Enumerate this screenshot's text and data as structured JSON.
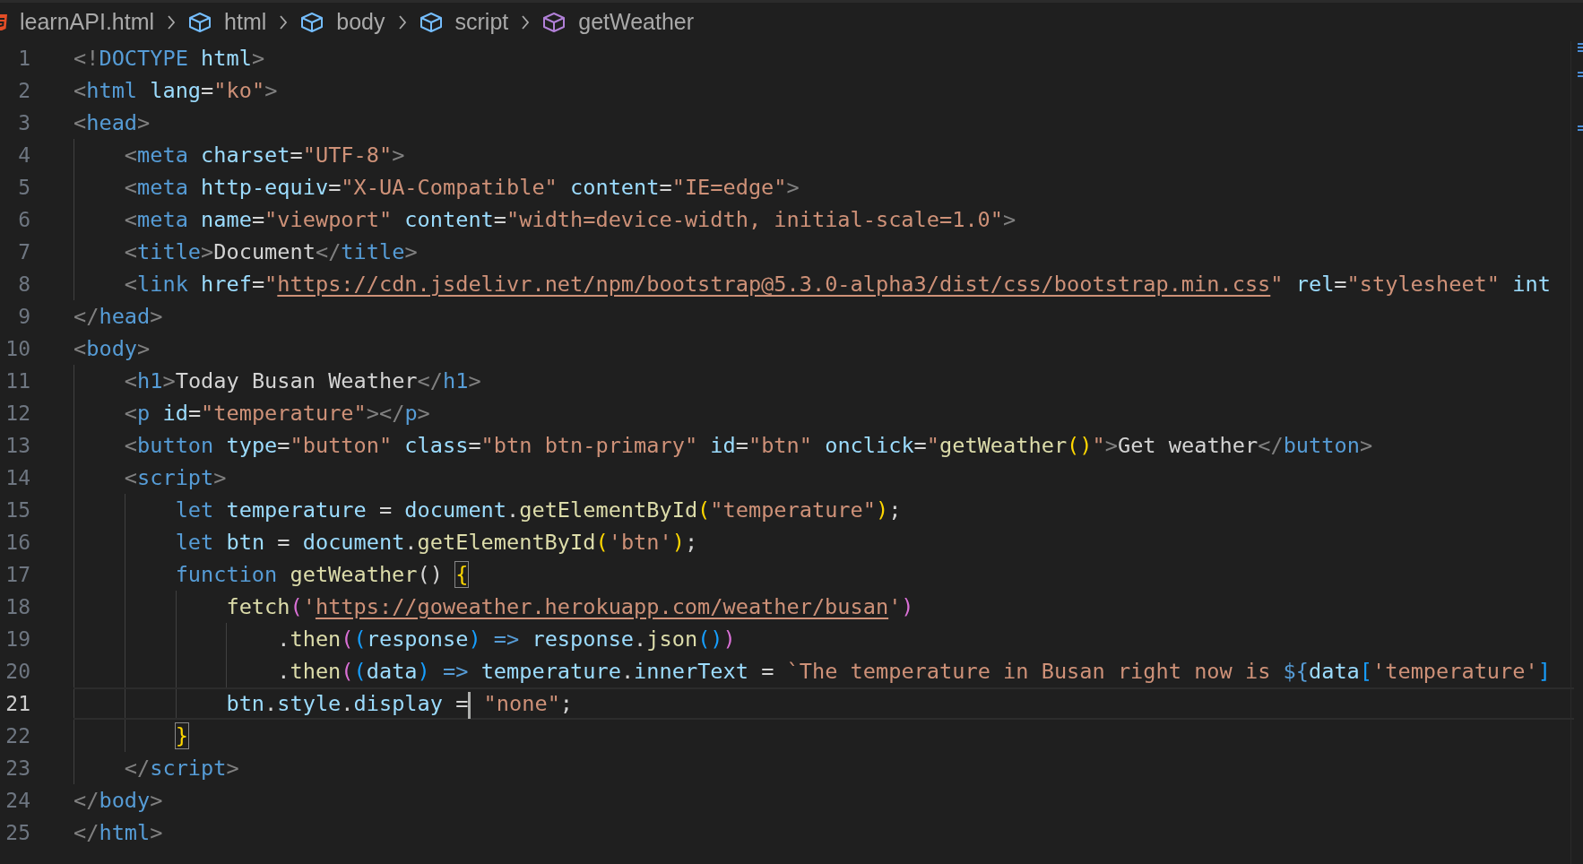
{
  "breadcrumb": [
    {
      "label": "learnAPI.html",
      "kind": "file"
    },
    {
      "label": "html",
      "kind": "element"
    },
    {
      "label": "body",
      "kind": "element"
    },
    {
      "label": "script",
      "kind": "element"
    },
    {
      "label": "getWeather",
      "kind": "function"
    }
  ],
  "lines": [
    {
      "number": "1",
      "current": false,
      "tokens": [
        {
          "text": "<!",
          "kind": "punct"
        },
        {
          "text": "DOCTYPE",
          "kind": "tag"
        },
        {
          "text": " html",
          "kind": "attr"
        },
        {
          "text": ">",
          "kind": "punct"
        }
      ]
    },
    {
      "number": "2",
      "current": false,
      "tokens": [
        {
          "text": "<",
          "kind": "punct"
        },
        {
          "text": "html",
          "kind": "tag"
        },
        {
          "text": " lang",
          "kind": "attr"
        },
        {
          "text": "=",
          "kind": "text"
        },
        {
          "text": "\"ko\"",
          "kind": "string"
        },
        {
          "text": ">",
          "kind": "punct"
        }
      ]
    },
    {
      "number": "3",
      "current": false,
      "tokens": [
        {
          "text": "<",
          "kind": "punct"
        },
        {
          "text": "head",
          "kind": "tag"
        },
        {
          "text": ">",
          "kind": "punct"
        }
      ]
    },
    {
      "number": "4",
      "current": false,
      "tokens": [
        {
          "text": "    <",
          "kind": "punct"
        },
        {
          "text": "meta",
          "kind": "tag"
        },
        {
          "text": " charset",
          "kind": "attr"
        },
        {
          "text": "=",
          "kind": "text"
        },
        {
          "text": "\"UTF-8\"",
          "kind": "string"
        },
        {
          "text": ">",
          "kind": "punct"
        }
      ]
    },
    {
      "number": "5",
      "current": false,
      "tokens": [
        {
          "text": "    <",
          "kind": "punct"
        },
        {
          "text": "meta",
          "kind": "tag"
        },
        {
          "text": " http-equiv",
          "kind": "attr"
        },
        {
          "text": "=",
          "kind": "text"
        },
        {
          "text": "\"X-UA-Compatible\"",
          "kind": "string"
        },
        {
          "text": " content",
          "kind": "attr"
        },
        {
          "text": "=",
          "kind": "text"
        },
        {
          "text": "\"IE=edge\"",
          "kind": "string"
        },
        {
          "text": ">",
          "kind": "punct"
        }
      ]
    },
    {
      "number": "6",
      "current": false,
      "tokens": [
        {
          "text": "    <",
          "kind": "punct"
        },
        {
          "text": "meta",
          "kind": "tag"
        },
        {
          "text": " name",
          "kind": "attr"
        },
        {
          "text": "=",
          "kind": "text"
        },
        {
          "text": "\"viewport\"",
          "kind": "string"
        },
        {
          "text": " content",
          "kind": "attr"
        },
        {
          "text": "=",
          "kind": "text"
        },
        {
          "text": "\"width=device-width, initial-scale=1.0\"",
          "kind": "string"
        },
        {
          "text": ">",
          "kind": "punct"
        }
      ]
    },
    {
      "number": "7",
      "current": false,
      "tokens": [
        {
          "text": "    <",
          "kind": "punct"
        },
        {
          "text": "title",
          "kind": "tag"
        },
        {
          "text": ">",
          "kind": "punct"
        },
        {
          "text": "Document",
          "kind": "text"
        },
        {
          "text": "</",
          "kind": "punct"
        },
        {
          "text": "title",
          "kind": "tag"
        },
        {
          "text": ">",
          "kind": "punct"
        }
      ]
    },
    {
      "number": "8",
      "current": false,
      "tokens": [
        {
          "text": "    <",
          "kind": "punct"
        },
        {
          "text": "link",
          "kind": "tag"
        },
        {
          "text": " href",
          "kind": "attr"
        },
        {
          "text": "=",
          "kind": "text"
        },
        {
          "text": "\"",
          "kind": "string"
        },
        {
          "text": "https://cdn.jsdelivr.net/npm/bootstrap@5.3.0-alpha3/dist/css/bootstrap.min.css",
          "kind": "link"
        },
        {
          "text": "\"",
          "kind": "string"
        },
        {
          "text": " rel",
          "kind": "attr"
        },
        {
          "text": "=",
          "kind": "text"
        },
        {
          "text": "\"stylesheet\"",
          "kind": "string"
        },
        {
          "text": " int",
          "kind": "attr"
        }
      ]
    },
    {
      "number": "9",
      "current": false,
      "tokens": [
        {
          "text": "</",
          "kind": "punct"
        },
        {
          "text": "head",
          "kind": "tag"
        },
        {
          "text": ">",
          "kind": "punct"
        }
      ]
    },
    {
      "number": "10",
      "current": false,
      "tokens": [
        {
          "text": "<",
          "kind": "punct"
        },
        {
          "text": "body",
          "kind": "tag"
        },
        {
          "text": ">",
          "kind": "punct"
        }
      ]
    },
    {
      "number": "11",
      "current": false,
      "tokens": [
        {
          "text": "    <",
          "kind": "punct"
        },
        {
          "text": "h1",
          "kind": "tag"
        },
        {
          "text": ">",
          "kind": "punct"
        },
        {
          "text": "Today Busan Weather",
          "kind": "text"
        },
        {
          "text": "</",
          "kind": "punct"
        },
        {
          "text": "h1",
          "kind": "tag"
        },
        {
          "text": ">",
          "kind": "punct"
        }
      ]
    },
    {
      "number": "12",
      "current": false,
      "tokens": [
        {
          "text": "    <",
          "kind": "punct"
        },
        {
          "text": "p",
          "kind": "tag"
        },
        {
          "text": " id",
          "kind": "attr"
        },
        {
          "text": "=",
          "kind": "text"
        },
        {
          "text": "\"temperature\"",
          "kind": "string"
        },
        {
          "text": "></",
          "kind": "punct"
        },
        {
          "text": "p",
          "kind": "tag"
        },
        {
          "text": ">",
          "kind": "punct"
        }
      ]
    },
    {
      "number": "13",
      "current": false,
      "tokens": [
        {
          "text": "    <",
          "kind": "punct"
        },
        {
          "text": "button",
          "kind": "tag"
        },
        {
          "text": " type",
          "kind": "attr"
        },
        {
          "text": "=",
          "kind": "text"
        },
        {
          "text": "\"button\"",
          "kind": "string"
        },
        {
          "text": " class",
          "kind": "attr"
        },
        {
          "text": "=",
          "kind": "text"
        },
        {
          "text": "\"btn btn-primary\"",
          "kind": "string"
        },
        {
          "text": " id",
          "kind": "attr"
        },
        {
          "text": "=",
          "kind": "text"
        },
        {
          "text": "\"btn\"",
          "kind": "string"
        },
        {
          "text": " onclick",
          "kind": "attr"
        },
        {
          "text": "=",
          "kind": "text"
        },
        {
          "text": "\"",
          "kind": "string"
        },
        {
          "text": "getWeather",
          "kind": "func"
        },
        {
          "text": "()",
          "kind": "bracket1"
        },
        {
          "text": "\"",
          "kind": "string"
        },
        {
          "text": ">",
          "kind": "punct"
        },
        {
          "text": "Get weather",
          "kind": "text"
        },
        {
          "text": "</",
          "kind": "punct"
        },
        {
          "text": "button",
          "kind": "tag"
        },
        {
          "text": ">",
          "kind": "punct"
        }
      ]
    },
    {
      "number": "14",
      "current": false,
      "tokens": [
        {
          "text": "    <",
          "kind": "punct"
        },
        {
          "text": "script",
          "kind": "tag"
        },
        {
          "text": ">",
          "kind": "punct"
        }
      ]
    },
    {
      "number": "15",
      "current": false,
      "tokens": [
        {
          "text": "        let",
          "kind": "keyword"
        },
        {
          "text": " temperature",
          "kind": "var"
        },
        {
          "text": " = ",
          "kind": "text"
        },
        {
          "text": "document",
          "kind": "var"
        },
        {
          "text": ".",
          "kind": "text"
        },
        {
          "text": "getElementById",
          "kind": "func"
        },
        {
          "text": "(",
          "kind": "bracket1"
        },
        {
          "text": "\"temperature\"",
          "kind": "string"
        },
        {
          "text": ")",
          "kind": "bracket1"
        },
        {
          "text": ";",
          "kind": "text"
        }
      ]
    },
    {
      "number": "16",
      "current": false,
      "tokens": [
        {
          "text": "        let",
          "kind": "keyword"
        },
        {
          "text": " btn",
          "kind": "var"
        },
        {
          "text": " = ",
          "kind": "text"
        },
        {
          "text": "document",
          "kind": "var"
        },
        {
          "text": ".",
          "kind": "text"
        },
        {
          "text": "getElementById",
          "kind": "func"
        },
        {
          "text": "(",
          "kind": "bracket1"
        },
        {
          "text": "'btn'",
          "kind": "string"
        },
        {
          "text": ")",
          "kind": "bracket1"
        },
        {
          "text": ";",
          "kind": "text"
        }
      ]
    },
    {
      "number": "17",
      "current": false,
      "tokens": [
        {
          "text": "        function",
          "kind": "keyword"
        },
        {
          "text": " getWeather",
          "kind": "func"
        },
        {
          "text": "() ",
          "kind": "text"
        },
        {
          "text": "{",
          "kind": "bracket1",
          "boxed": true
        }
      ]
    },
    {
      "number": "18",
      "current": false,
      "tokens": [
        {
          "text": "            fetch",
          "kind": "func"
        },
        {
          "text": "(",
          "kind": "bracket2"
        },
        {
          "text": "'",
          "kind": "string"
        },
        {
          "text": "https://goweather.herokuapp.com/weather/busan",
          "kind": "link"
        },
        {
          "text": "'",
          "kind": "string"
        },
        {
          "text": ")",
          "kind": "bracket2"
        }
      ]
    },
    {
      "number": "19",
      "current": false,
      "tokens": [
        {
          "text": "                .",
          "kind": "text"
        },
        {
          "text": "then",
          "kind": "func"
        },
        {
          "text": "(",
          "kind": "bracket2"
        },
        {
          "text": "(",
          "kind": "bracket3"
        },
        {
          "text": "response",
          "kind": "var"
        },
        {
          "text": ")",
          "kind": "bracket3"
        },
        {
          "text": " => ",
          "kind": "keyword"
        },
        {
          "text": "response",
          "kind": "var"
        },
        {
          "text": ".",
          "kind": "text"
        },
        {
          "text": "json",
          "kind": "func"
        },
        {
          "text": "()",
          "kind": "bracket3"
        },
        {
          "text": ")",
          "kind": "bracket2"
        }
      ]
    },
    {
      "number": "20",
      "current": false,
      "tokens": [
        {
          "text": "                .",
          "kind": "text"
        },
        {
          "text": "then",
          "kind": "func"
        },
        {
          "text": "(",
          "kind": "bracket2"
        },
        {
          "text": "(",
          "kind": "bracket3"
        },
        {
          "text": "data",
          "kind": "var"
        },
        {
          "text": ")",
          "kind": "bracket3"
        },
        {
          "text": " => ",
          "kind": "keyword"
        },
        {
          "text": "temperature",
          "kind": "var"
        },
        {
          "text": ".",
          "kind": "text"
        },
        {
          "text": "innerText",
          "kind": "var"
        },
        {
          "text": " = ",
          "kind": "text"
        },
        {
          "text": "`The temperature in Busan right now is ",
          "kind": "string"
        },
        {
          "text": "${",
          "kind": "keyword"
        },
        {
          "text": "data",
          "kind": "var"
        },
        {
          "text": "[",
          "kind": "bracket3"
        },
        {
          "text": "'temperature'",
          "kind": "string"
        },
        {
          "text": "]",
          "kind": "bracket3"
        }
      ]
    },
    {
      "number": "21",
      "current": true,
      "tokens": [
        {
          "text": "            btn",
          "kind": "var"
        },
        {
          "text": ".",
          "kind": "text"
        },
        {
          "text": "style",
          "kind": "var"
        },
        {
          "text": ".",
          "kind": "text"
        },
        {
          "text": "display",
          "kind": "var"
        },
        {
          "text": " =",
          "kind": "text",
          "cursor": true
        },
        {
          "text": " \"none\"",
          "kind": "string"
        },
        {
          "text": ";",
          "kind": "text"
        }
      ]
    },
    {
      "number": "22",
      "current": false,
      "tokens": [
        {
          "text": "        }",
          "kind": "bracket1",
          "boxed": true
        }
      ]
    },
    {
      "number": "23",
      "current": false,
      "tokens": [
        {
          "text": "    </",
          "kind": "punct"
        },
        {
          "text": "script",
          "kind": "tag"
        },
        {
          "text": ">",
          "kind": "punct"
        }
      ]
    },
    {
      "number": "24",
      "current": false,
      "tokens": [
        {
          "text": "</",
          "kind": "punct"
        },
        {
          "text": "body",
          "kind": "tag"
        },
        {
          "text": ">",
          "kind": "punct"
        }
      ]
    },
    {
      "number": "25",
      "current": false,
      "tokens": [
        {
          "text": "</",
          "kind": "punct"
        },
        {
          "text": "html",
          "kind": "tag"
        },
        {
          "text": ">",
          "kind": "punct"
        }
      ]
    }
  ]
}
